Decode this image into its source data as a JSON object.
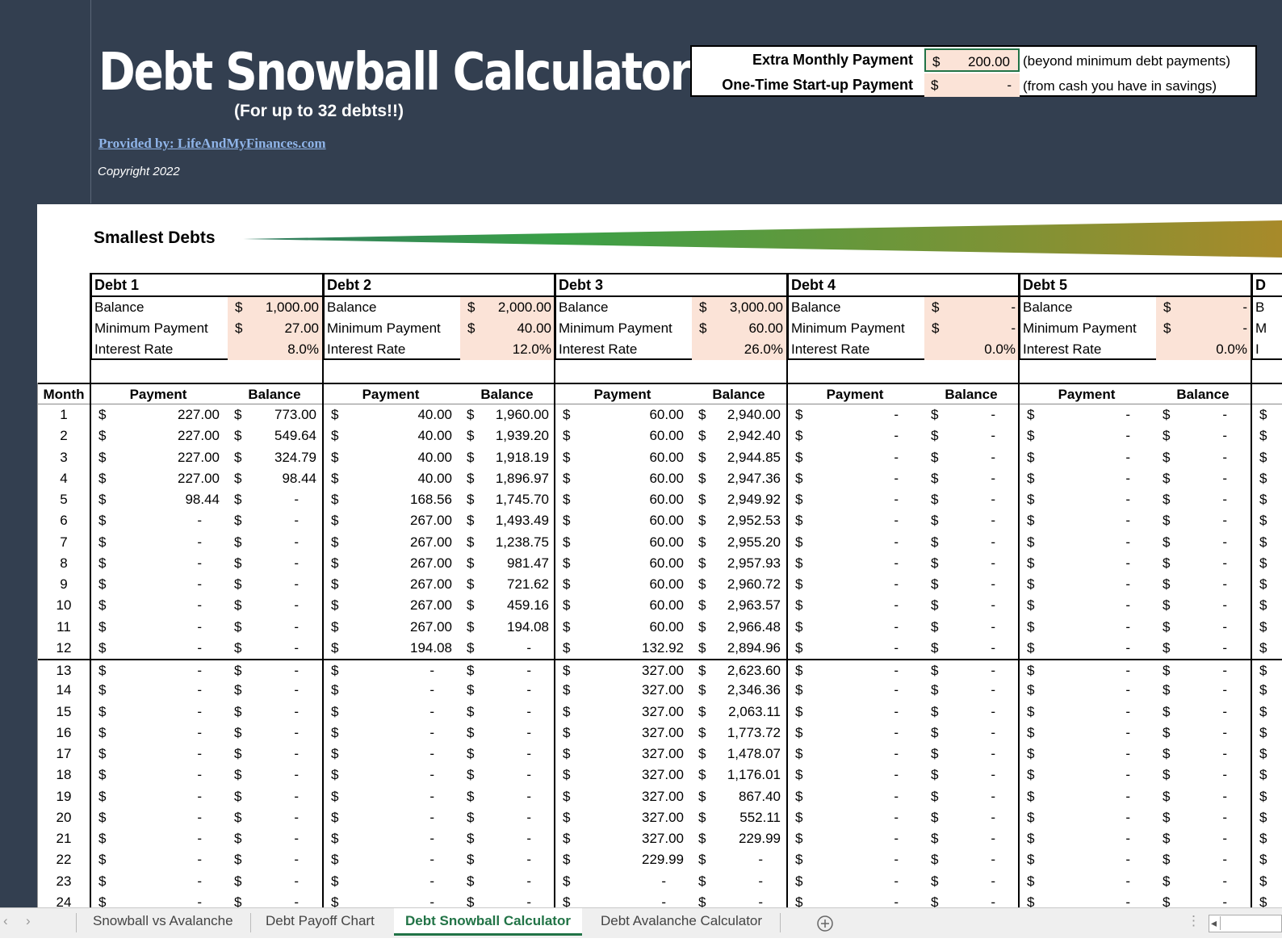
{
  "header": {
    "title": "Debt Snowball Calculator",
    "subtitle": "(For up to 32 debts!!)",
    "provider": "Provided by: LifeAndMyFinances.com",
    "copyright": "Copyright 2022"
  },
  "inputs": {
    "extra_label": "Extra Monthly Payment",
    "extra_currency": "$",
    "extra_value": "200.00",
    "extra_note": "(beyond minimum debt payments)",
    "onetime_label": "One-Time Start-up Payment",
    "onetime_currency": "$",
    "onetime_value": "-",
    "onetime_note": "(from cash you have in savings)"
  },
  "section_title": "Smallest Debts",
  "debts": [
    {
      "name": "Debt 1",
      "balance": "1,000.00",
      "min_payment": "27.00",
      "rate": "8.0%"
    },
    {
      "name": "Debt 2",
      "balance": "2,000.00",
      "min_payment": "40.00",
      "rate": "12.0%"
    },
    {
      "name": "Debt 3",
      "balance": "3,000.00",
      "min_payment": "60.00",
      "rate": "26.0%"
    },
    {
      "name": "Debt 4",
      "balance": "-",
      "min_payment": "-",
      "rate": "0.0%"
    },
    {
      "name": "Debt 5",
      "balance": "-",
      "min_payment": "-",
      "rate": "0.0%"
    }
  ],
  "labels": {
    "balance": "Balance",
    "min_payment": "Minimum Payment",
    "rate": "Interest Rate",
    "currency": "$",
    "month": "Month",
    "payment": "Payment",
    "balance_col": "Balance",
    "debt6_head": "D",
    "debt6_r1": "B",
    "debt6_r2": "M",
    "debt6_r3": "I"
  },
  "schedule": [
    {
      "m": "1",
      "v": [
        "227.00",
        "773.00",
        "40.00",
        "1,960.00",
        "60.00",
        "2,940.00",
        "-",
        "-",
        "-",
        "-"
      ]
    },
    {
      "m": "2",
      "v": [
        "227.00",
        "549.64",
        "40.00",
        "1,939.20",
        "60.00",
        "2,942.40",
        "-",
        "-",
        "-",
        "-"
      ]
    },
    {
      "m": "3",
      "v": [
        "227.00",
        "324.79",
        "40.00",
        "1,918.19",
        "60.00",
        "2,944.85",
        "-",
        "-",
        "-",
        "-"
      ]
    },
    {
      "m": "4",
      "v": [
        "227.00",
        "98.44",
        "40.00",
        "1,896.97",
        "60.00",
        "2,947.36",
        "-",
        "-",
        "-",
        "-"
      ]
    },
    {
      "m": "5",
      "v": [
        "98.44",
        "-",
        "168.56",
        "1,745.70",
        "60.00",
        "2,949.92",
        "-",
        "-",
        "-",
        "-"
      ]
    },
    {
      "m": "6",
      "v": [
        "-",
        "-",
        "267.00",
        "1,493.49",
        "60.00",
        "2,952.53",
        "-",
        "-",
        "-",
        "-"
      ]
    },
    {
      "m": "7",
      "v": [
        "-",
        "-",
        "267.00",
        "1,238.75",
        "60.00",
        "2,955.20",
        "-",
        "-",
        "-",
        "-"
      ]
    },
    {
      "m": "8",
      "v": [
        "-",
        "-",
        "267.00",
        "981.47",
        "60.00",
        "2,957.93",
        "-",
        "-",
        "-",
        "-"
      ]
    },
    {
      "m": "9",
      "v": [
        "-",
        "-",
        "267.00",
        "721.62",
        "60.00",
        "2,960.72",
        "-",
        "-",
        "-",
        "-"
      ]
    },
    {
      "m": "10",
      "v": [
        "-",
        "-",
        "267.00",
        "459.16",
        "60.00",
        "2,963.57",
        "-",
        "-",
        "-",
        "-"
      ]
    },
    {
      "m": "11",
      "v": [
        "-",
        "-",
        "267.00",
        "194.08",
        "60.00",
        "2,966.48",
        "-",
        "-",
        "-",
        "-"
      ]
    },
    {
      "m": "12",
      "v": [
        "-",
        "-",
        "194.08",
        "-",
        "132.92",
        "2,894.96",
        "-",
        "-",
        "-",
        "-"
      ]
    },
    {
      "m": "13",
      "v": [
        "-",
        "-",
        "-",
        "-",
        "327.00",
        "2,623.60",
        "-",
        "-",
        "-",
        "-"
      ]
    },
    {
      "m": "14",
      "v": [
        "-",
        "-",
        "-",
        "-",
        "327.00",
        "2,346.36",
        "-",
        "-",
        "-",
        "-"
      ]
    },
    {
      "m": "15",
      "v": [
        "-",
        "-",
        "-",
        "-",
        "327.00",
        "2,063.11",
        "-",
        "-",
        "-",
        "-"
      ]
    },
    {
      "m": "16",
      "v": [
        "-",
        "-",
        "-",
        "-",
        "327.00",
        "1,773.72",
        "-",
        "-",
        "-",
        "-"
      ]
    },
    {
      "m": "17",
      "v": [
        "-",
        "-",
        "-",
        "-",
        "327.00",
        "1,478.07",
        "-",
        "-",
        "-",
        "-"
      ]
    },
    {
      "m": "18",
      "v": [
        "-",
        "-",
        "-",
        "-",
        "327.00",
        "1,176.01",
        "-",
        "-",
        "-",
        "-"
      ]
    },
    {
      "m": "19",
      "v": [
        "-",
        "-",
        "-",
        "-",
        "327.00",
        "867.40",
        "-",
        "-",
        "-",
        "-"
      ]
    },
    {
      "m": "20",
      "v": [
        "-",
        "-",
        "-",
        "-",
        "327.00",
        "552.11",
        "-",
        "-",
        "-",
        "-"
      ]
    },
    {
      "m": "21",
      "v": [
        "-",
        "-",
        "-",
        "-",
        "327.00",
        "229.99",
        "-",
        "-",
        "-",
        "-"
      ]
    },
    {
      "m": "22",
      "v": [
        "-",
        "-",
        "-",
        "-",
        "229.99",
        "-",
        "-",
        "-",
        "-",
        "-"
      ]
    },
    {
      "m": "23",
      "v": [
        "-",
        "-",
        "-",
        "-",
        "-",
        "-",
        "-",
        "-",
        "-",
        "-"
      ]
    },
    {
      "m": "24",
      "v": [
        "-",
        "-",
        "-",
        "-",
        "-",
        "-",
        "-",
        "-",
        "-",
        "-"
      ]
    }
  ],
  "tabs": [
    {
      "label": "Snowball vs Avalanche",
      "active": false
    },
    {
      "label": "Debt Payoff Chart",
      "active": false
    },
    {
      "label": "Debt Snowball Calculator",
      "active": true
    },
    {
      "label": "Debt Avalanche Calculator",
      "active": false
    }
  ],
  "icons": {
    "add_sheet": "plus-circle-icon",
    "scroll_left": "chevron-left-icon"
  },
  "colors": {
    "header_bg": "#333f50",
    "input_fill": "#fbe3d7",
    "accent": "#217346",
    "gradient_start": "#2e9e4f",
    "gradient_end": "#a08a2c"
  }
}
